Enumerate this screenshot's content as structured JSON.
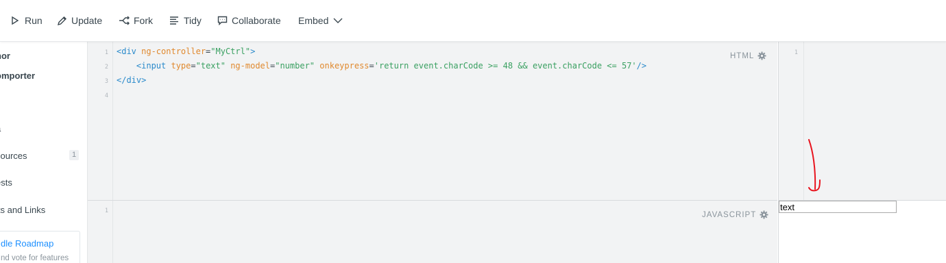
{
  "toolbar": {
    "run": "Run",
    "update": "Update",
    "fork": "Fork",
    "tidy": "Tidy",
    "collaborate": "Collaborate",
    "embed": "Embed"
  },
  "sidebar": {
    "items": [
      {
        "label": "hor"
      },
      {
        "label": "omporter"
      },
      {
        "label": "a"
      },
      {
        "label": "sources",
        "badge": "1"
      },
      {
        "label": "ests"
      },
      {
        "label": "its and Links"
      }
    ],
    "roadmap_title": "dle Roadmap",
    "roadmap_sub": "nd vote for features"
  },
  "html_panel": {
    "label": "HTML",
    "line_numbers": [
      "1",
      "2",
      "3",
      "4"
    ],
    "lines": [
      [
        {
          "t": "<div ",
          "c": "tag"
        },
        {
          "t": "ng-controller",
          "c": "attr"
        },
        {
          "t": "=",
          "c": "plain"
        },
        {
          "t": "\"MyCtrl\"",
          "c": "str"
        },
        {
          "t": ">",
          "c": "tag"
        }
      ],
      [
        {
          "t": "    <input ",
          "c": "tag"
        },
        {
          "t": "type",
          "c": "attr"
        },
        {
          "t": "=",
          "c": "plain"
        },
        {
          "t": "\"text\" ",
          "c": "str"
        },
        {
          "t": "ng-model",
          "c": "attr"
        },
        {
          "t": "=",
          "c": "plain"
        },
        {
          "t": "\"number\" ",
          "c": "str"
        },
        {
          "t": "onkeypress",
          "c": "attr"
        },
        {
          "t": "=",
          "c": "plain"
        },
        {
          "t": "'return event.charCode >= 48 && event.charCode <= 57'",
          "c": "str"
        },
        {
          "t": "/>",
          "c": "tag"
        }
      ],
      [
        {
          "t": "</div>",
          "c": "tag"
        }
      ],
      []
    ]
  },
  "js_panel": {
    "label": "JAVASCRIPT",
    "line_numbers": [
      "1"
    ]
  },
  "result_panel": {
    "line_numbers": [
      "1"
    ],
    "input_value": "text"
  },
  "colors": {
    "tag": "#2a8acb",
    "attr": "#e0892e",
    "string": "#3aa061",
    "annotation": "#e8141e"
  }
}
